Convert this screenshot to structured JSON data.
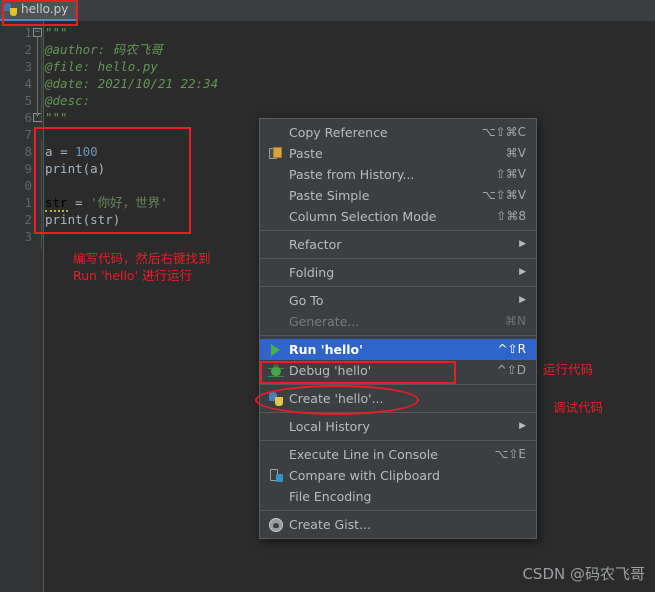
{
  "app": {
    "name": "PyCharm Editor",
    "theme_bg": "#2b2b2b",
    "menu_bg": "#3c3f41",
    "accent_selected": "#2f65ca",
    "annotation_color": "#ee1c24"
  },
  "tab": {
    "icon": "python-file-icon",
    "label": "hello.py",
    "chevron": "›"
  },
  "editor": {
    "line_numbers": [
      "1",
      "2",
      "3",
      "4",
      "5",
      "6",
      "7",
      "8",
      "9",
      "0",
      "1",
      "2",
      "3"
    ],
    "lines": [
      {
        "n": 1,
        "segments": [
          {
            "cls": "doc",
            "text": "\"\"\""
          }
        ]
      },
      {
        "n": 2,
        "segments": [
          {
            "cls": "doc",
            "text": "@author: 码农飞哥"
          }
        ]
      },
      {
        "n": 3,
        "segments": [
          {
            "cls": "doc",
            "text": "@file: hello.py"
          }
        ]
      },
      {
        "n": 4,
        "segments": [
          {
            "cls": "doc",
            "text": "@date: 2021/10/21 22:34"
          }
        ]
      },
      {
        "n": 5,
        "segments": [
          {
            "cls": "doc",
            "text": "@desc:"
          }
        ]
      },
      {
        "n": 6,
        "segments": [
          {
            "cls": "doc",
            "text": "\"\"\""
          }
        ]
      },
      {
        "n": 7,
        "segments": []
      },
      {
        "n": 8,
        "segments": [
          {
            "cls": "plain",
            "text": "a "
          },
          {
            "cls": "plain",
            "text": "= "
          },
          {
            "cls": "num",
            "text": "100"
          }
        ]
      },
      {
        "n": 9,
        "segments": [
          {
            "cls": "fn",
            "text": "print(a)"
          }
        ]
      },
      {
        "n": 10,
        "segments": []
      },
      {
        "n": 11,
        "segments": [
          {
            "cls": "warnu",
            "text": "str"
          },
          {
            "cls": "plain",
            "text": " = "
          },
          {
            "cls": "str",
            "text": "'你好，世界'"
          }
        ]
      },
      {
        "n": 12,
        "segments": [
          {
            "cls": "fn",
            "text": "print(str)"
          }
        ]
      },
      {
        "n": 13,
        "segments": []
      }
    ]
  },
  "annotations": {
    "code_note": "编写代码，然后右键找到\nRun 'hello' 进行运行",
    "run_note": "运行代码",
    "debug_note": "调试代码"
  },
  "context_menu": {
    "groups": [
      {
        "items": [
          {
            "icon": null,
            "label": "Copy Reference",
            "shortcut": "⌥⇧⌘C",
            "submenu": false,
            "disabled": false,
            "selected": false
          },
          {
            "icon": "paste-icon",
            "label": "Paste",
            "shortcut": "⌘V",
            "submenu": false,
            "disabled": false,
            "selected": false
          },
          {
            "icon": null,
            "label": "Paste from History...",
            "shortcut": "⇧⌘V",
            "submenu": false,
            "disabled": false,
            "selected": false
          },
          {
            "icon": null,
            "label": "Paste Simple",
            "shortcut": "⌥⇧⌘V",
            "submenu": false,
            "disabled": false,
            "selected": false
          },
          {
            "icon": null,
            "label": "Column Selection Mode",
            "shortcut": "⇧⌘8",
            "submenu": false,
            "disabled": false,
            "selected": false
          }
        ]
      },
      {
        "items": [
          {
            "icon": null,
            "label": "Refactor",
            "shortcut": "",
            "submenu": true,
            "disabled": false,
            "selected": false
          }
        ]
      },
      {
        "items": [
          {
            "icon": null,
            "label": "Folding",
            "shortcut": "",
            "submenu": true,
            "disabled": false,
            "selected": false
          }
        ]
      },
      {
        "items": [
          {
            "icon": null,
            "label": "Go To",
            "shortcut": "",
            "submenu": true,
            "disabled": false,
            "selected": false
          },
          {
            "icon": null,
            "label": "Generate...",
            "shortcut": "⌘N",
            "submenu": false,
            "disabled": true,
            "selected": false
          }
        ]
      },
      {
        "items": [
          {
            "icon": "run-icon",
            "label": "Run 'hello'",
            "shortcut": "^⇧R",
            "submenu": false,
            "disabled": false,
            "selected": true
          },
          {
            "icon": "debug-icon",
            "label": "Debug 'hello'",
            "shortcut": "^⇧D",
            "submenu": false,
            "disabled": false,
            "selected": false
          }
        ]
      },
      {
        "items": [
          {
            "icon": "python-icon",
            "label": "Create 'hello'...",
            "shortcut": "",
            "submenu": false,
            "disabled": false,
            "selected": false
          }
        ]
      },
      {
        "items": [
          {
            "icon": null,
            "label": "Local History",
            "shortcut": "",
            "submenu": true,
            "disabled": false,
            "selected": false
          }
        ]
      },
      {
        "items": [
          {
            "icon": null,
            "label": "Execute Line in Console",
            "shortcut": "⌥⇧E",
            "submenu": false,
            "disabled": false,
            "selected": false
          },
          {
            "icon": "clipboard-diff-icon",
            "label": "Compare with Clipboard",
            "shortcut": "",
            "submenu": false,
            "disabled": false,
            "selected": false
          },
          {
            "icon": null,
            "label": "File Encoding",
            "shortcut": "",
            "submenu": false,
            "disabled": false,
            "selected": false
          }
        ]
      },
      {
        "items": [
          {
            "icon": "github-icon",
            "label": "Create Gist...",
            "shortcut": "",
            "submenu": false,
            "disabled": false,
            "selected": false
          }
        ]
      }
    ]
  },
  "watermark": {
    "text": "CSDN @码农飞哥"
  }
}
